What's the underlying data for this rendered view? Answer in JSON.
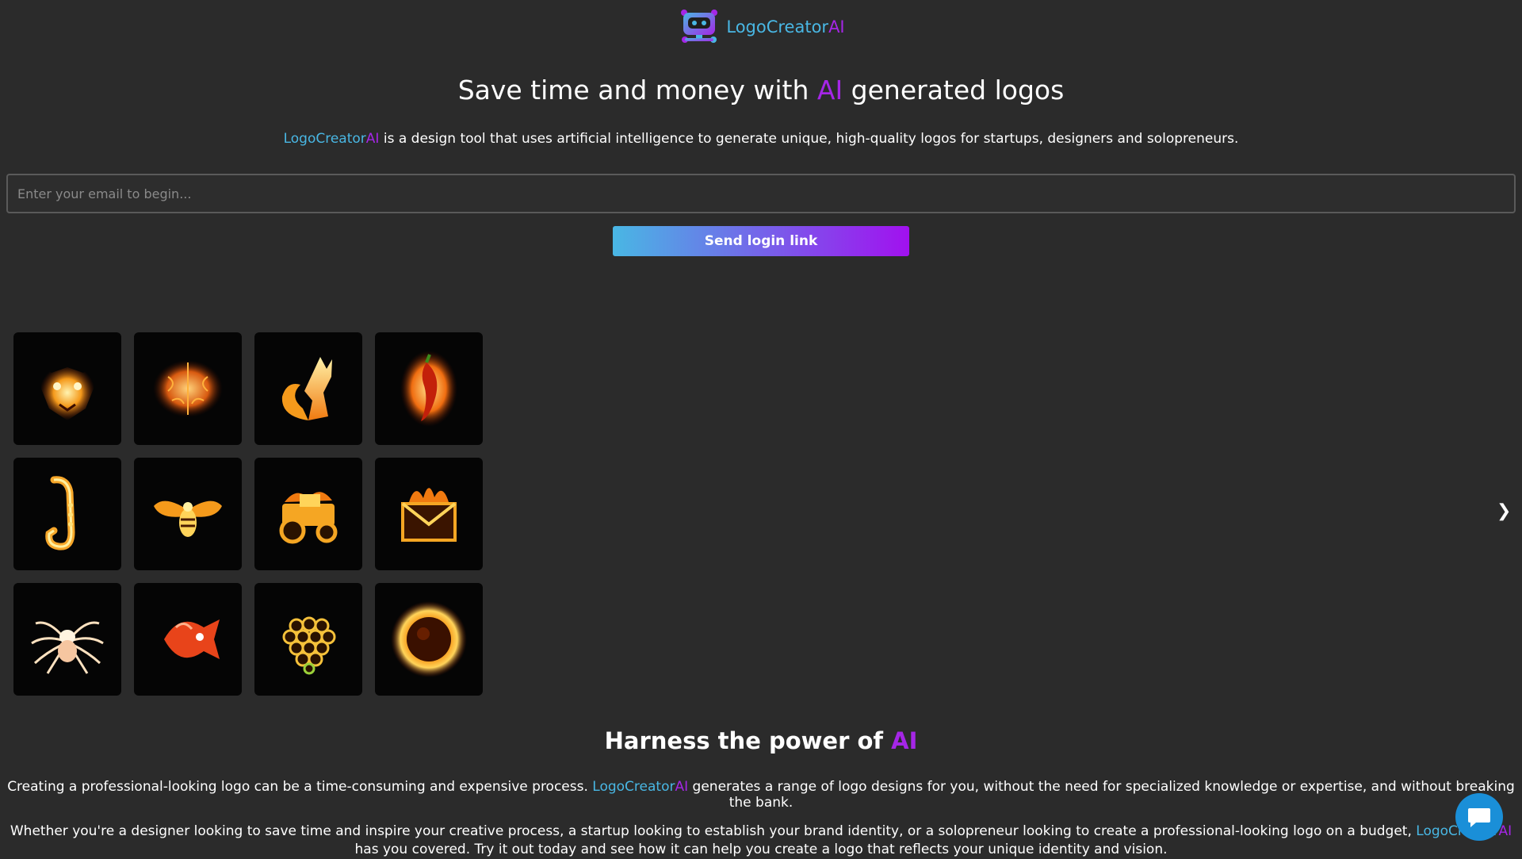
{
  "brand": {
    "name_main": "LogoCreator",
    "name_accent": "AI",
    "icon": "robot-logo-icon"
  },
  "hero": {
    "headline_before": "Save time and money with ",
    "headline_accent": "AI",
    "headline_after": " generated logos",
    "subtitle_brand_main": "LogoCreator",
    "subtitle_brand_accent": "AI",
    "subtitle_rest": " is a design tool that uses artificial intelligence to generate unique, high-quality logos for startups, designers and solopreneurs."
  },
  "signup": {
    "email_placeholder": "Enter your email to begin...",
    "email_value": "",
    "send_label": "Send login link"
  },
  "gallery": {
    "items": [
      {
        "icon": "fire-tiger-icon"
      },
      {
        "icon": "fire-brain-icon"
      },
      {
        "icon": "fire-fox-icon"
      },
      {
        "icon": "fire-chili-icon"
      },
      {
        "icon": "fire-saxophone-icon"
      },
      {
        "icon": "fire-bee-icon"
      },
      {
        "icon": "fire-tractor-icon"
      },
      {
        "icon": "fire-envelope-icon"
      },
      {
        "icon": "fire-spider-icon"
      },
      {
        "icon": "fire-fish-icon"
      },
      {
        "icon": "fire-grapes-icon"
      },
      {
        "icon": "fire-sun-icon"
      }
    ],
    "prev_label": "❮",
    "next_label": "❯"
  },
  "features": {
    "title_before": "Harness the power of ",
    "title_accent": "AI",
    "para1_before": "Creating a professional-looking logo can be a time-consuming and expensive process. ",
    "para1_brand_main": "LogoCreator",
    "para1_brand_accent": "AI",
    "para1_after": " generates a range of logo designs for you, without the need for specialized knowledge or expertise, and without breaking the bank.",
    "para2_before": "Whether you're a designer looking to save time and inspire your creative process, a startup looking to establish your brand identity, or a solopreneur looking to create a professional-looking logo on a budget, ",
    "para2_brand_main": "LogoCreator",
    "para2_brand_accent": "AI",
    "para2_after": " has you covered. Try it out today and see how it can help you create a logo that reflects your unique identity and vision."
  },
  "chat": {
    "icon": "chat-bubble-icon"
  },
  "colors": {
    "background": "#2b2b2b",
    "brand_blue": "#49b7e4",
    "brand_purple": "#a526e6",
    "button_gradient_start": "#49b7e4",
    "button_gradient_end": "#a111ef",
    "chat_blue": "#1a8fd8"
  }
}
